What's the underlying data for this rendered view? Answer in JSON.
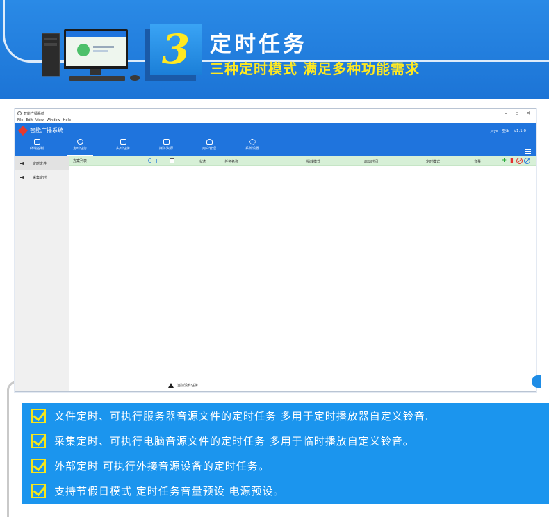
{
  "banner": {
    "number": "3",
    "title": "定时任务",
    "subtitle": "三种定时模式  满足多种功能需求"
  },
  "app": {
    "window_title": "智能广播系统",
    "window_controls": [
      "–",
      "▫",
      "✕"
    ],
    "menu": [
      "File",
      "Edit",
      "View",
      "Window",
      "Help"
    ],
    "logo_text": "智能广播系统",
    "user": {
      "name": "jxyc",
      "logout": "登出",
      "version": "V1.1.0"
    },
    "nav_tabs": [
      {
        "label": "终端控制",
        "icon": "terminal-icon"
      },
      {
        "label": "定时任务",
        "icon": "clock-icon",
        "active": true
      },
      {
        "label": "实时任务",
        "icon": "music-icon"
      },
      {
        "label": "媒体资源",
        "icon": "media-icon"
      },
      {
        "label": "用户管理",
        "icon": "user-icon"
      },
      {
        "label": "系统设置",
        "icon": "gear-icon"
      }
    ],
    "sidebar": [
      {
        "label": "定时文件",
        "active": true
      },
      {
        "label": "采集定时"
      }
    ],
    "plan_list": {
      "header": "方案列表",
      "refresh": "C",
      "add": "+"
    },
    "task_table": {
      "columns": [
        "状态",
        "任务名称",
        "播放模式",
        "启动时间",
        "定时模式",
        "音量"
      ],
      "actions": {
        "add": "+",
        "delete": "▮"
      },
      "status_message": "当前没有任务"
    }
  },
  "features": [
    "文件定时、可执行服务器音源文件的定时任务 多用于定时播放器自定义铃音.",
    "采集定时、可执行电脑音源文件的定时任务 多用于临时播放自定义铃音。",
    "外部定时 可执行外接音源设备的定时任务。",
    "支持节假日模式 定时任务音量预设 电源预设。"
  ],
  "colors": {
    "banner_blue": "#1c74d6",
    "accent_yellow": "#ffe820",
    "app_header_blue": "#1f74dd",
    "table_header_green": "#d7f0d7",
    "feature_blue": "#1b95ee"
  }
}
